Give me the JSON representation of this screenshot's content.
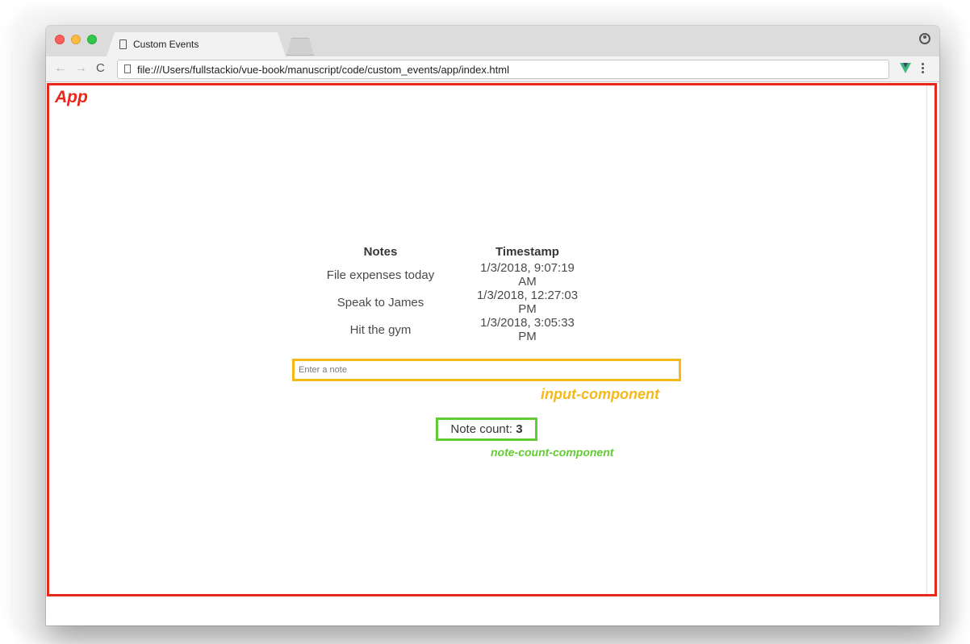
{
  "browser": {
    "tab_title": "Custom Events",
    "tab_close": "×",
    "url": "file:///Users/fullstackio/vue-book/manuscript/code/custom_events/app/index.html",
    "nav_back": "←",
    "nav_forward": "→",
    "nav_reload": "C",
    "icons": [
      "document-icon",
      "close-icon",
      "profile-icon",
      "back-arrow-icon",
      "forward-arrow-icon",
      "reload-icon",
      "vue-devtools-icon",
      "menu-dots-icon"
    ]
  },
  "annotations": {
    "app_label": "App",
    "input_component_label": "input-component",
    "note_count_component_label": "note-count-component",
    "colors": {
      "app": "#e8281b",
      "input_component": "#f5b918",
      "note_count_component": "#62cb31"
    }
  },
  "notes_table": {
    "headers": [
      "Notes",
      "Timestamp"
    ],
    "rows": [
      {
        "note": "File expenses today",
        "timestamp": "1/3/2018, 9:07:19 AM"
      },
      {
        "note": "Speak to James",
        "timestamp": "1/3/2018, 12:27:03 PM"
      },
      {
        "note": "Hit the gym",
        "timestamp": "1/3/2018, 3:05:33 PM"
      }
    ]
  },
  "input": {
    "placeholder": "Enter a note",
    "value": ""
  },
  "note_count": {
    "label": "Note count: ",
    "value": "3"
  }
}
